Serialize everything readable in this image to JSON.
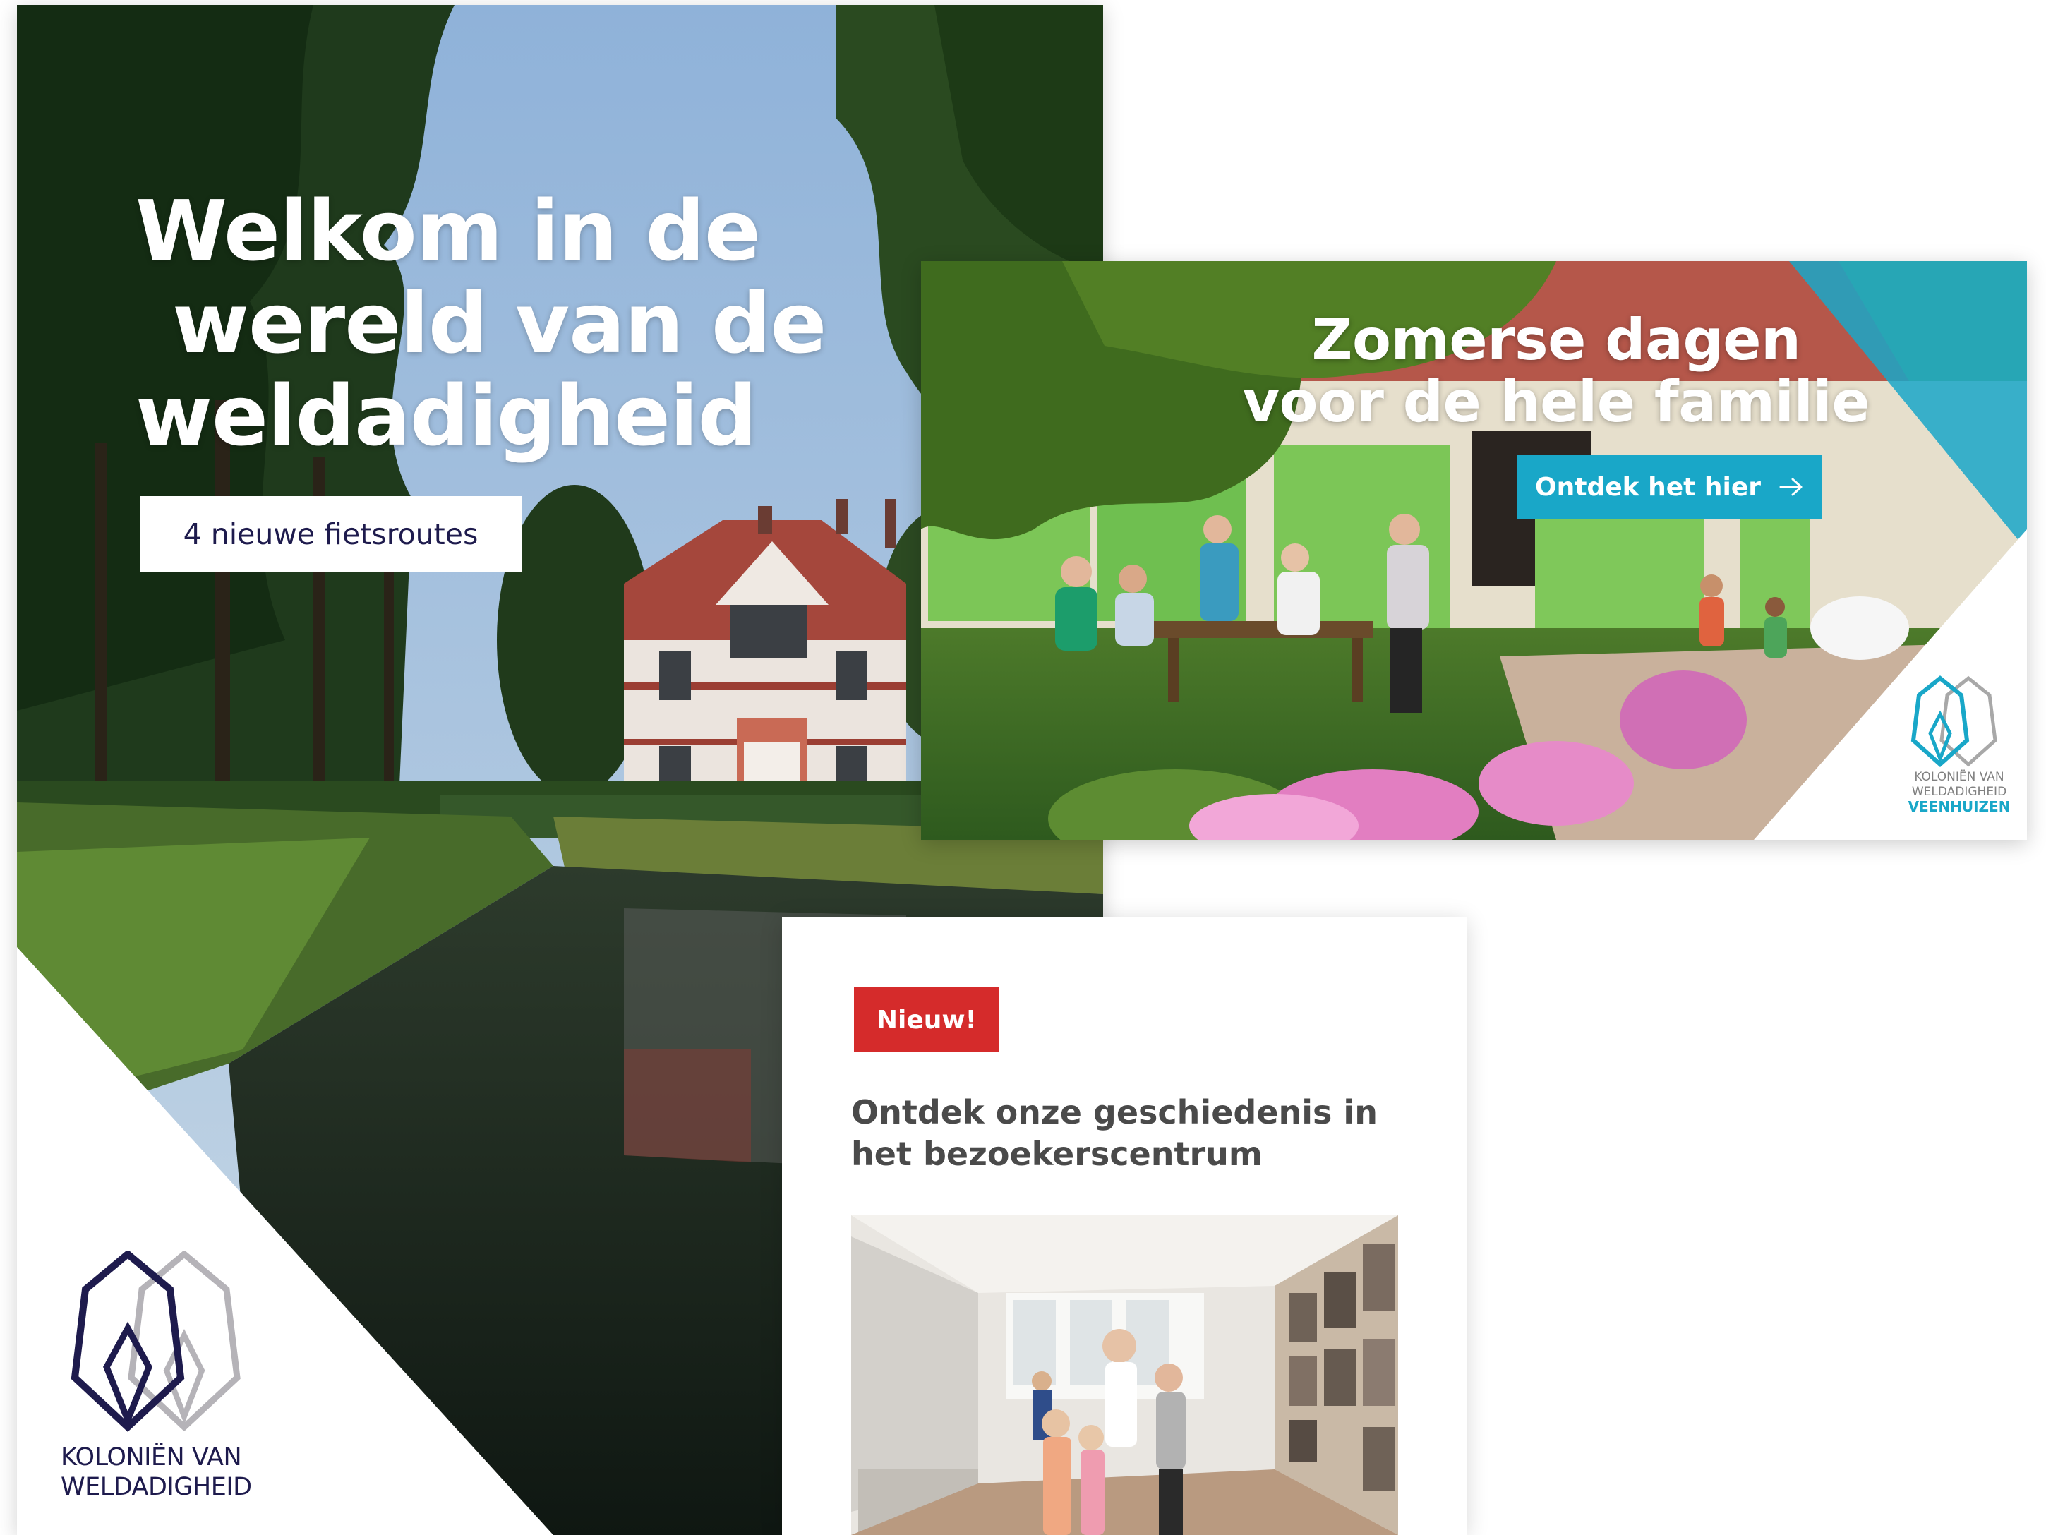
{
  "hero": {
    "title_lines": [
      "Welkom in de",
      "wereld van de",
      "weldadigheid"
    ],
    "button_label": "4 nieuwe fietsroutes",
    "logo_line1": "KOLONIËN VAN",
    "logo_line2": "WELDADIGHEID",
    "colors": {
      "navy": "#1e1b4d",
      "grey": "#b5b3b8"
    }
  },
  "family_banner": {
    "title_lines": [
      "Zomerse dagen",
      "voor de hele familie"
    ],
    "button_label": "Ontdek het hier",
    "button_icon": "arrow-right-icon",
    "logo_line1": "KOLONIËN VAN",
    "logo_line2": "WELDADIGHEID",
    "logo_line3": "VEENHUIZEN",
    "colors": {
      "accent": "#19a7c8"
    }
  },
  "news_card": {
    "badge": "Nieuw!",
    "title_lines": [
      "Ontdek onze geschiedenis in",
      "het bezoekerscentrum"
    ],
    "colors": {
      "badge": "#d52b2b"
    }
  }
}
